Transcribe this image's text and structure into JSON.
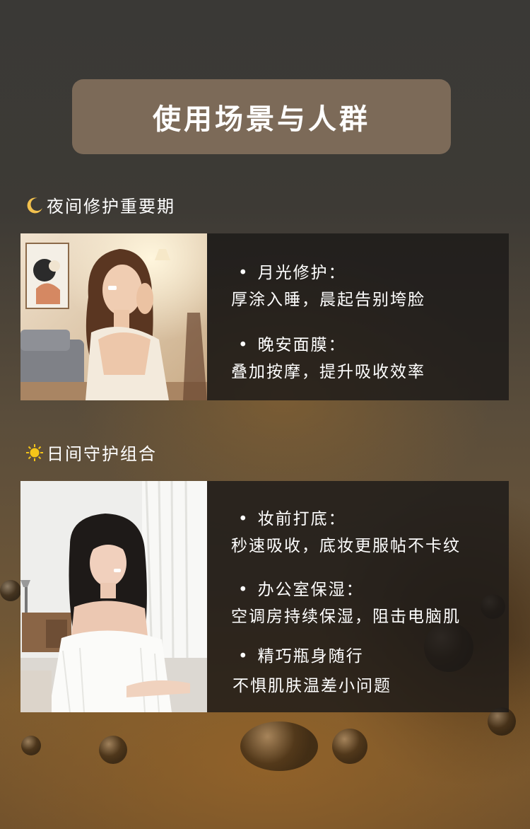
{
  "header": {
    "title": "使用场景与人群"
  },
  "sections": [
    {
      "icon": "moon-icon",
      "title": "夜间修护重要期",
      "photo": "woman-applying-cream-evening-photo",
      "items": [
        {
          "title": "月光修护：",
          "desc": "厚涂入睡，晨起告别垮脸"
        },
        {
          "title": "晚安面膜：",
          "desc": "叠加按摩，提升吸收效率"
        }
      ]
    },
    {
      "icon": "sun-icon",
      "title": "日间守护组合",
      "photo": "woman-at-desk-daytime-photo",
      "items": [
        {
          "title": "妆前打底：",
          "desc": "秒速吸收，底妆更服帖不卡纹"
        },
        {
          "title": "办公室保湿：",
          "desc": "空调房持续保湿，阻击电脑肌"
        },
        {
          "title": "精巧瓶身随行",
          "desc": "不惧肌肤温差小问题"
        }
      ]
    }
  ],
  "colors": {
    "header_bg": "#7c6a58",
    "card_bg": "#1c1a18",
    "moon": "#f2c14e",
    "sun": "#f5c518"
  }
}
